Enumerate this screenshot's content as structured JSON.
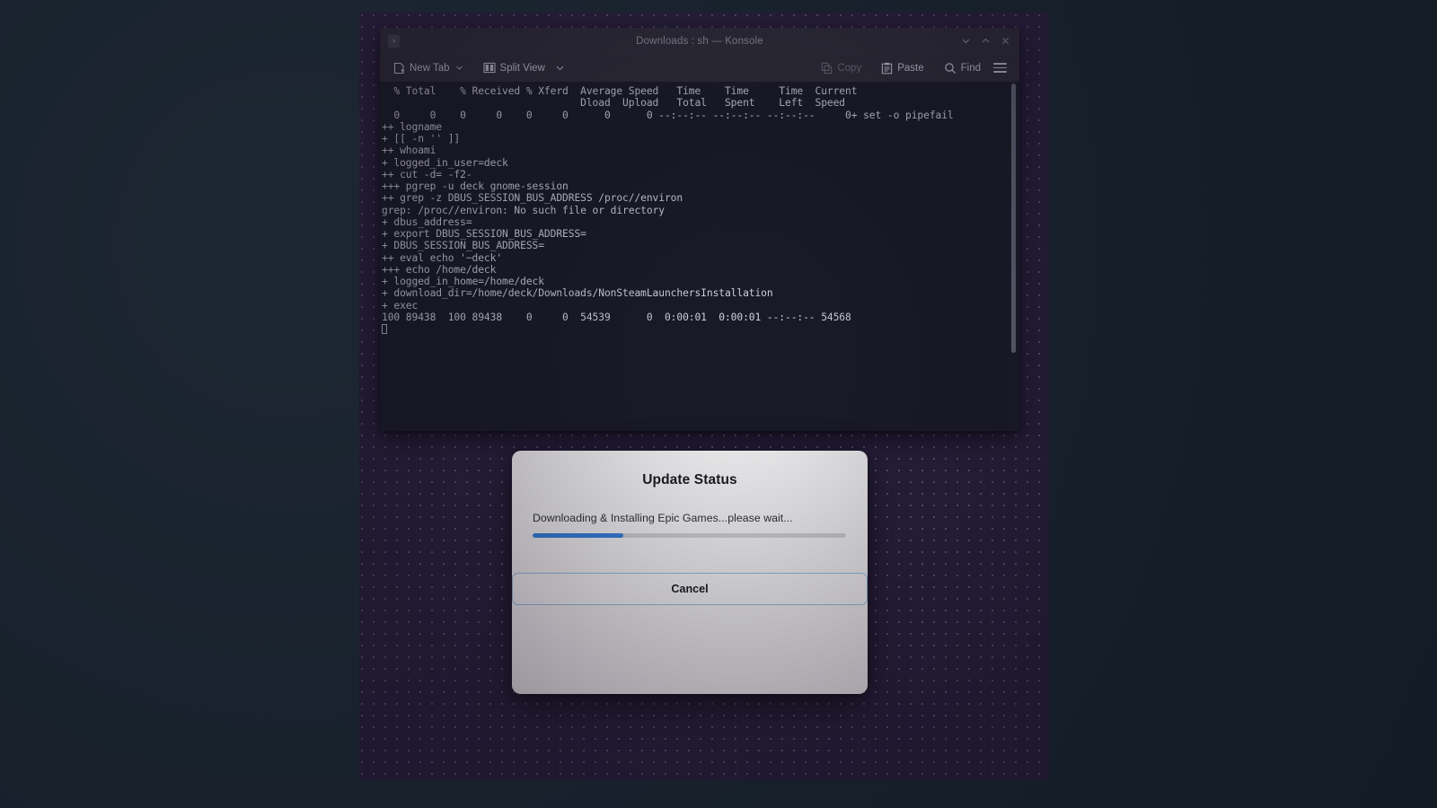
{
  "window": {
    "title": "Downloads : sh — Konsole",
    "tab_icon": "terminal-icon",
    "controls": {
      "minimize": "minimize-icon",
      "maximize": "maximize-icon",
      "close": "close-icon"
    }
  },
  "toolbar": {
    "new_tab": "New Tab",
    "split_view": "Split View",
    "copy": "Copy",
    "paste": "Paste",
    "find": "Find",
    "menu": "hamburger-menu-icon"
  },
  "terminal": {
    "lines": [
      "  % Total    % Received % Xferd  Average Speed   Time    Time     Time  Current",
      "                                 Dload  Upload   Total   Spent    Left  Speed",
      "  0     0    0     0    0     0      0      0 --:--:-- --:--:-- --:--:--     0+ set -o pipefail",
      "++ logname",
      "+ [[ -n '' ]]",
      "++ whoami",
      "+ logged_in_user=deck",
      "++ cut -d= -f2-",
      "+++ pgrep -u deck gnome-session",
      "++ grep -z DBUS_SESSION_BUS_ADDRESS /proc//environ",
      "grep: /proc//environ: No such file or directory",
      "+ dbus_address=",
      "+ export DBUS_SESSION_BUS_ADDRESS=",
      "+ DBUS_SESSION_BUS_ADDRESS=",
      "++ eval echo '~deck'",
      "+++ echo /home/deck",
      "+ logged_in_home=/home/deck",
      "+ download_dir=/home/deck/Downloads/NonSteamLaunchersInstallation",
      "+ exec",
      "100 89438  100 89438    0     0  54539      0  0:00:01  0:00:01 --:--:-- 54568"
    ]
  },
  "dialog": {
    "title": "Update Status",
    "message": "Downloading & Installing Epic Games...please wait...",
    "progress_percent": 29,
    "cancel_label": "Cancel"
  },
  "colors": {
    "accent_blue": "#3584e4",
    "desktop_purple": "#2b2340",
    "terminal_bg": "#181b26",
    "dialog_bg": "#fafafa"
  }
}
